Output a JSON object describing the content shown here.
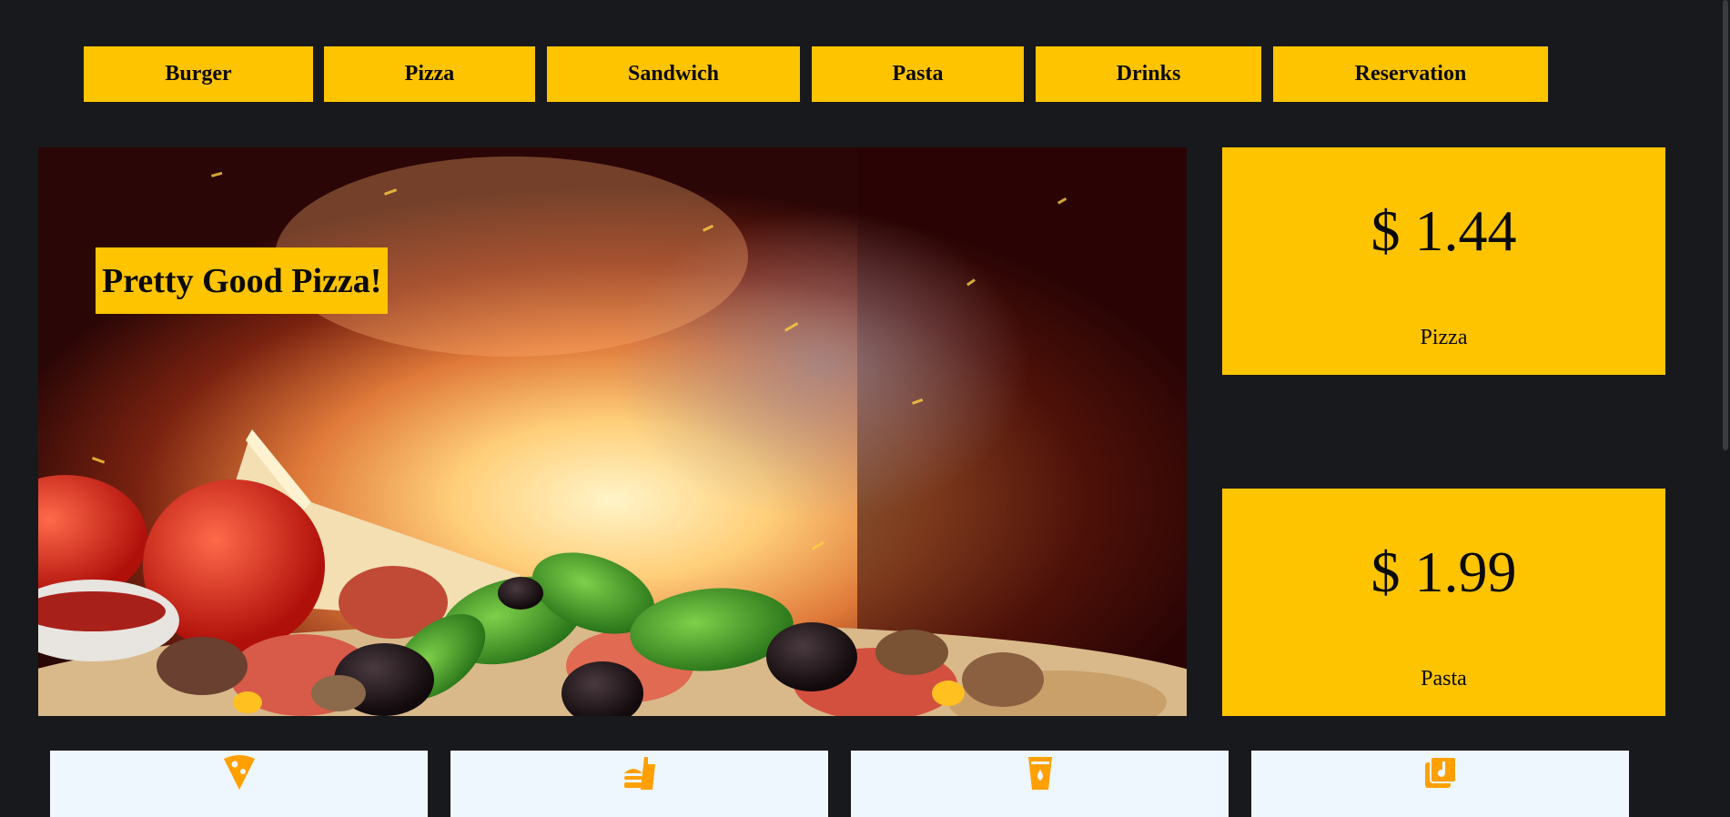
{
  "nav": {
    "items": [
      {
        "label": "Burger"
      },
      {
        "label": "Pizza"
      },
      {
        "label": "Sandwich"
      },
      {
        "label": "Pasta"
      },
      {
        "label": "Drinks"
      },
      {
        "label": "Reservation"
      }
    ]
  },
  "hero": {
    "title": "Pretty Good Pizza!"
  },
  "prices": [
    {
      "value": "$ 1.44",
      "label": "Pizza"
    },
    {
      "value": "$ 1.99",
      "label": "Pasta"
    }
  ],
  "cards": [
    {
      "icon": "pizza-slice-icon"
    },
    {
      "icon": "fast-food-icon"
    },
    {
      "icon": "drink-cup-icon"
    },
    {
      "icon": "music-library-icon"
    }
  ],
  "colors": {
    "background": "#18191c",
    "accent": "#ffc400",
    "card_background": "#eef6fe",
    "icon": "#ffa000"
  }
}
